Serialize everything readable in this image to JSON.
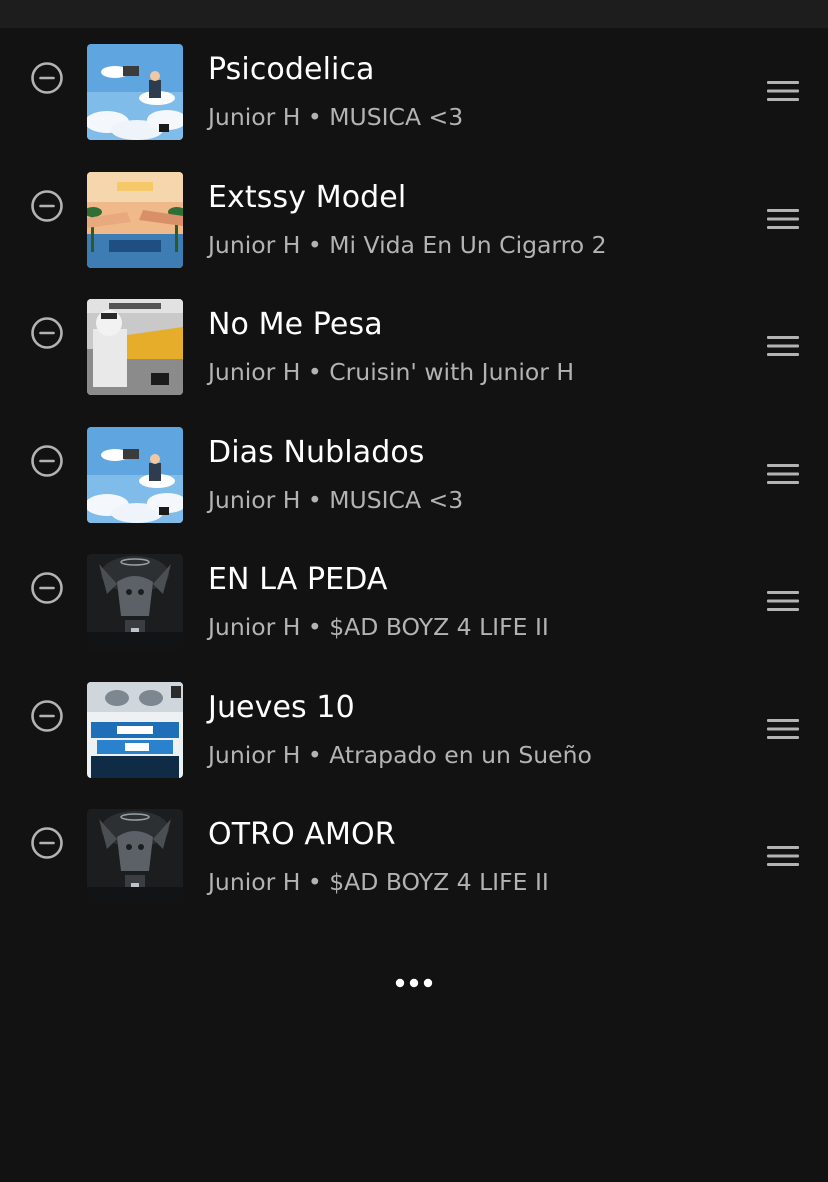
{
  "colors": {
    "background": "#121212",
    "top_bar": "#1d1d1d",
    "primary_text": "#ffffff",
    "secondary_text": "#b3b3b3",
    "icon": "#b3b3b3"
  },
  "icons": {
    "remove": "minus-circle-icon",
    "drag": "drag-handle-icon",
    "more": "more-horizontal-icon"
  },
  "tracks": [
    {
      "title": "Psicodelica",
      "subtitle": "Junior H • MUSICA <3",
      "art": "sky"
    },
    {
      "title": "Extssy Model",
      "subtitle": "Junior H • Mi Vida En Un Cigarro 2",
      "art": "hands"
    },
    {
      "title": "No Me Pesa",
      "subtitle": "Junior H • Cruisin' with Junior H",
      "art": "car"
    },
    {
      "title": "Dias Nublados",
      "subtitle": "Junior H • MUSICA <3",
      "art": "sky"
    },
    {
      "title": "EN LA PEDA",
      "subtitle": "Junior H • $AD BOYZ 4 LIFE II",
      "art": "dark"
    },
    {
      "title": "Jueves 10",
      "subtitle": "Junior H • Atrapado en un Sueño",
      "art": "atrapado"
    },
    {
      "title": "OTRO AMOR",
      "subtitle": "Junior H • $AD BOYZ 4 LIFE II",
      "art": "dark"
    }
  ]
}
